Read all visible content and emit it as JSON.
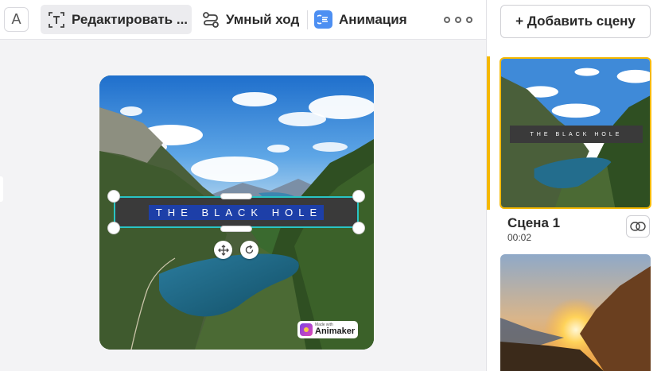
{
  "toolbar": {
    "font_icon_glyph": "A",
    "edit_label": "Редактировать ...",
    "smart_move_label": "Умный ход",
    "animation_label": "Анимация"
  },
  "canvas": {
    "text": "THE BLACK HOLE",
    "watermark_small": "Made with",
    "watermark_brand": "Animaker"
  },
  "right_panel": {
    "add_scene_label": "+ Добавить сцену",
    "scenes": [
      {
        "name": "Сцена 1",
        "duration": "00:02",
        "thumb_text": "THE BLACK HOLE"
      }
    ]
  },
  "colors": {
    "selection": "#29c4c4",
    "active_scene": "#f5b800",
    "text_highlight": "#1d3fa8",
    "animation_icon": "#4d8ff2"
  }
}
